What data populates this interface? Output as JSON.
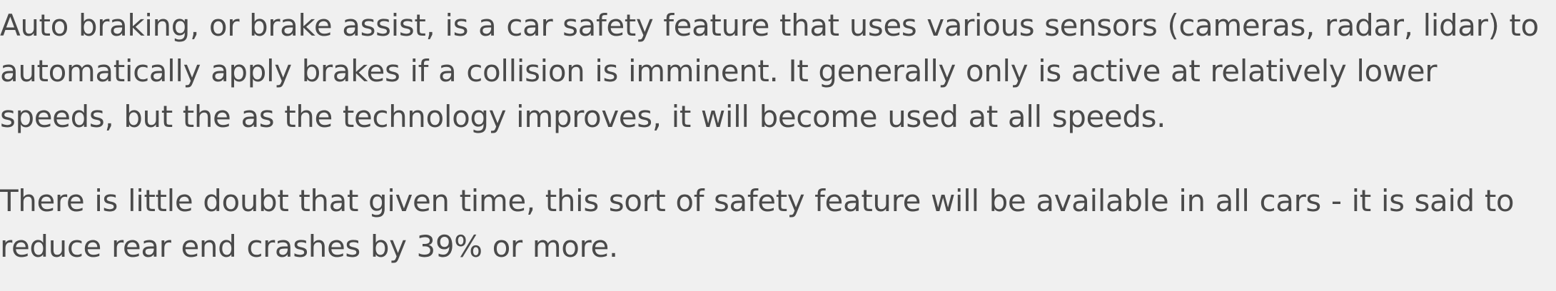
{
  "article": {
    "paragraphs": [
      {
        "lines": [
          "Auto braking, or brake assist, is a car safety feature that uses various sensors (cameras, radar, lidar) to",
          "automatically apply brakes if a collision is imminent. It generally only is active at relatively lower",
          "speeds, but the as the technology improves, it will become used at all speeds."
        ]
      },
      {
        "lines": [
          "There is little doubt that given time, this sort of safety feature will be available in all cars - it is said to",
          "reduce rear end crashes by 39% or more."
        ]
      }
    ]
  }
}
